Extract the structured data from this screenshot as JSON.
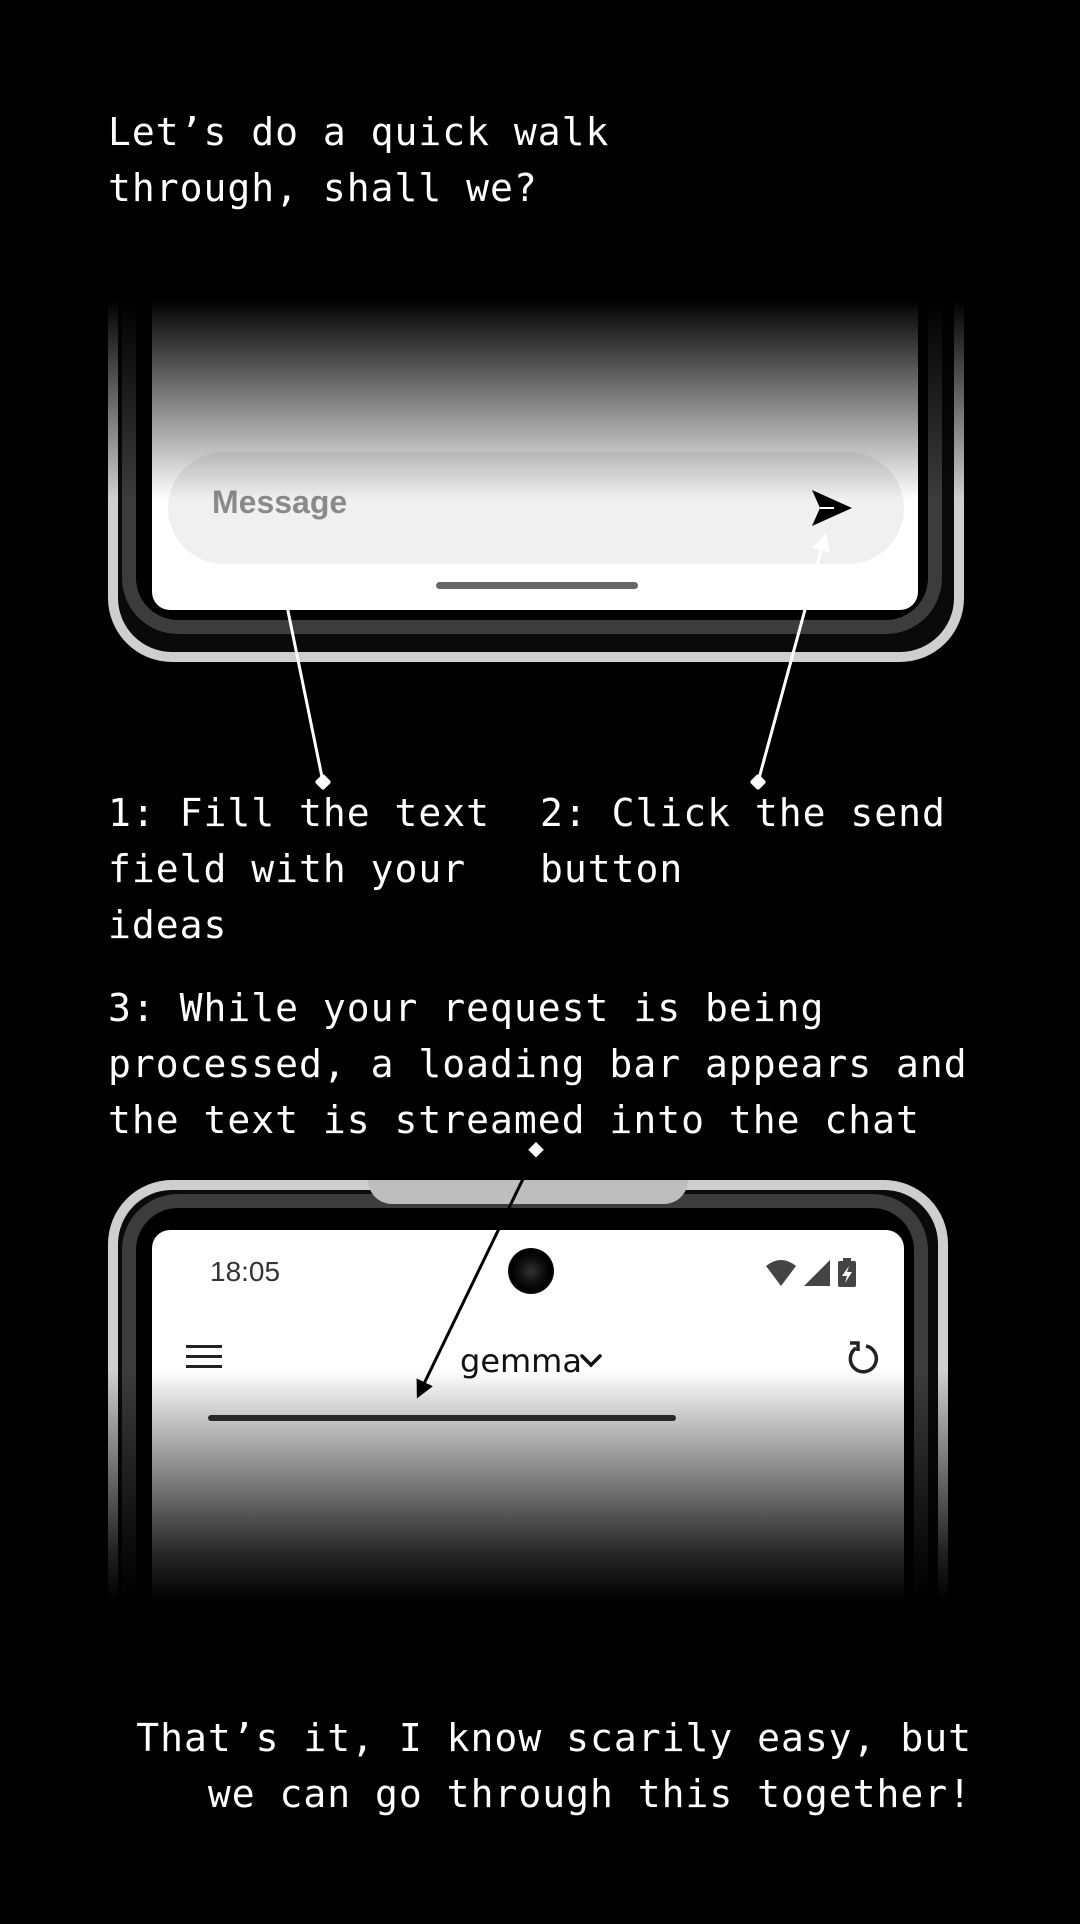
{
  "intro_text": "Let’s do a quick walk\nthrough, shall we?",
  "step1_text": "1: Fill the text\nfield with your\nideas",
  "step2_text": "2: Click the send\nbutton",
  "step3_text": "3: While your request is being\nprocessed, a loading bar appears and\nthe text is streamed into the chat",
  "outro_text": "That’s it, I know scarily easy, but\nwe can go through this together!",
  "chat_input": {
    "placeholder": "Message",
    "icon": "send-icon"
  },
  "app_bar": {
    "status_time": "18:05",
    "model_name": "gemma",
    "menu_icon": "hamburger-menu-icon",
    "model_dropdown_icon": "chevron-down-icon",
    "refresh_icon": "refresh-icon",
    "status_icons": [
      "wifi-icon",
      "cellular-signal-icon",
      "battery-charging-icon"
    ]
  },
  "colors": {
    "background": "#000000",
    "text": "#ffffff",
    "screen": "#ffffff",
    "input_bg": "#f0f0f0",
    "placeholder": "#8a8a8a"
  }
}
